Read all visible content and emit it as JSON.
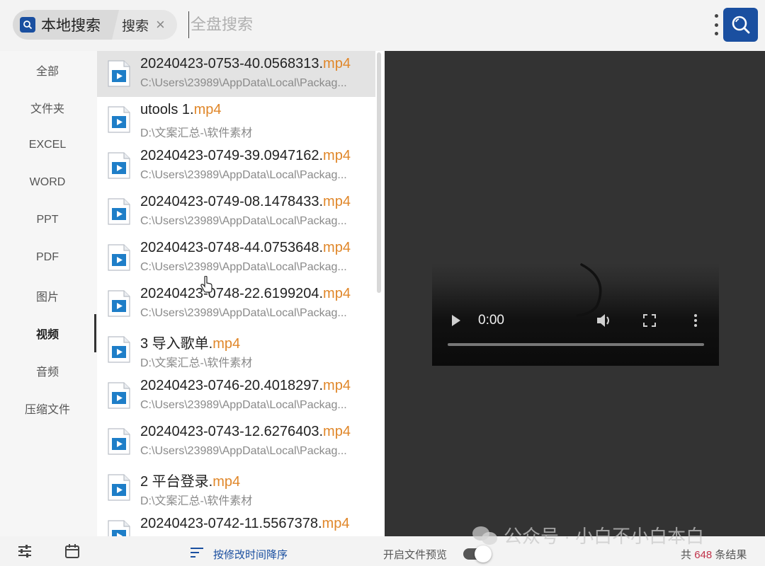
{
  "search": {
    "scope_label": "本地搜索",
    "sub_tag": "搜索",
    "placeholder": "全盘搜索",
    "value": ""
  },
  "sidebar": {
    "items": [
      {
        "label": "全部"
      },
      {
        "label": "文件夹"
      },
      {
        "label": "EXCEL"
      },
      {
        "label": "WORD"
      },
      {
        "label": "PPT"
      },
      {
        "label": "PDF"
      },
      {
        "label": "图片"
      },
      {
        "label": "视频",
        "active": true
      },
      {
        "label": "音频"
      },
      {
        "label": "压缩文件"
      }
    ]
  },
  "files": [
    {
      "base": "20240423-0753-40.0568313.",
      "ext": "mp4",
      "path": "C:\\Users\\23989\\AppData\\Local\\Packag...",
      "selected": true
    },
    {
      "base": "utools 1.",
      "ext": "mp4",
      "path": "D:\\文案汇总-\\软件素材"
    },
    {
      "base": "20240423-0749-39.0947162.",
      "ext": "mp4",
      "path": "C:\\Users\\23989\\AppData\\Local\\Packag..."
    },
    {
      "base": "20240423-0749-08.1478433.",
      "ext": "mp4",
      "path": "C:\\Users\\23989\\AppData\\Local\\Packag..."
    },
    {
      "base": "20240423-0748-44.0753648.",
      "ext": "mp4",
      "path": "C:\\Users\\23989\\AppData\\Local\\Packag..."
    },
    {
      "base": "20240423-0748-22.6199204.",
      "ext": "mp4",
      "path": "C:\\Users\\23989\\AppData\\Local\\Packag..."
    },
    {
      "base": "3 导入歌单.",
      "ext": "mp4",
      "path": "D:\\文案汇总-\\软件素材"
    },
    {
      "base": "20240423-0746-20.4018297.",
      "ext": "mp4",
      "path": "C:\\Users\\23989\\AppData\\Local\\Packag..."
    },
    {
      "base": "20240423-0743-12.6276403.",
      "ext": "mp4",
      "path": "C:\\Users\\23989\\AppData\\Local\\Packag..."
    },
    {
      "base": "2 平台登录.",
      "ext": "mp4",
      "path": "D:\\文案汇总-\\软件素材"
    },
    {
      "base": "20240423-0742-11.5567378.",
      "ext": "mp4",
      "path": ""
    }
  ],
  "player": {
    "time": "0:00",
    "progress": 0
  },
  "statusbar": {
    "sort_label": "按修改时间降序",
    "preview_label": "开启文件预览",
    "preview_enabled": true,
    "result_prefix": "共",
    "result_count": "648",
    "result_suffix": "条结果"
  },
  "watermark": {
    "text": "公众号 · 小白不小白本白"
  },
  "colors": {
    "accent": "#1a4fa0",
    "extension": "#e0872a",
    "count": "#c0334a",
    "preview_bg": "#333333"
  }
}
